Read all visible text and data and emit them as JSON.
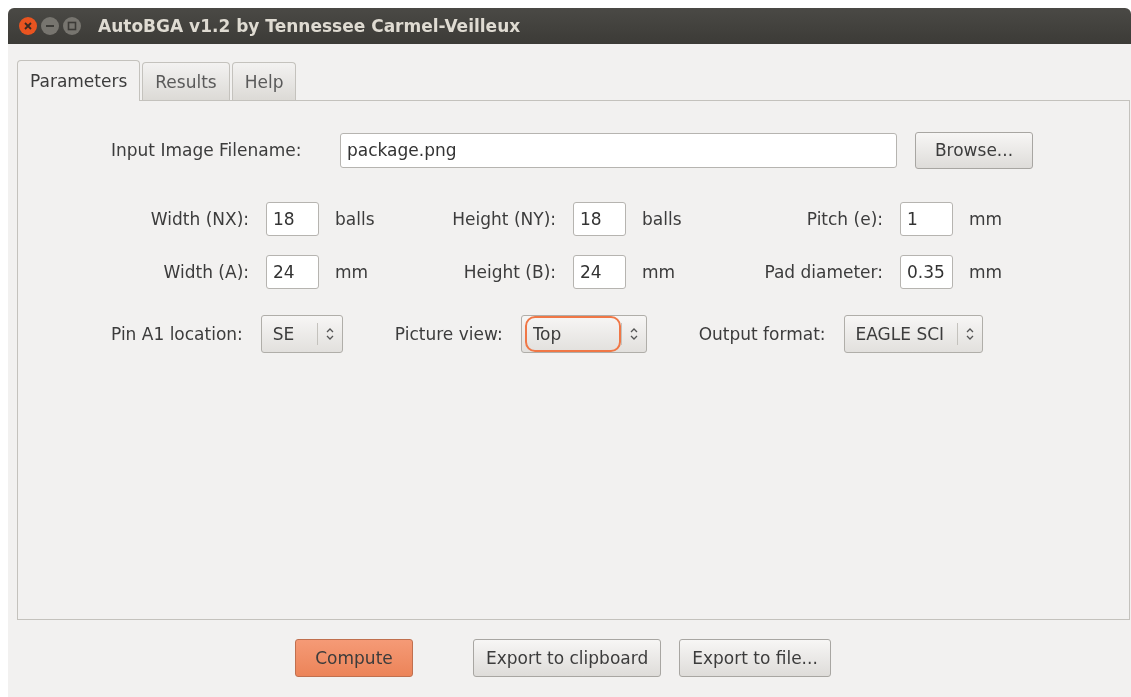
{
  "window": {
    "title": "AutoBGA v1.2 by Tennessee Carmel-Veilleux"
  },
  "tabs": [
    {
      "label": "Parameters",
      "selected": true
    },
    {
      "label": "Results",
      "selected": false
    },
    {
      "label": "Help",
      "selected": false
    }
  ],
  "filename": {
    "label": "Input Image Filename:",
    "value": "package.png",
    "button": "Browse..."
  },
  "grid_rows": [
    [
      {
        "label": "Width (NX):",
        "value": "18",
        "unit": "balls"
      },
      {
        "label": "Height (NY):",
        "value": "18",
        "unit": "balls"
      },
      {
        "label": "Pitch (e):",
        "value": "1",
        "unit": "mm"
      }
    ],
    [
      {
        "label": "Width (A):",
        "value": "24",
        "unit": "mm"
      },
      {
        "label": "Height (B):",
        "value": "24",
        "unit": "mm"
      },
      {
        "label": "Pad diameter:",
        "value": "0.35",
        "unit": "mm"
      }
    ]
  ],
  "selects": [
    {
      "label": "Pin A1 location:",
      "value": "SE",
      "focused": false
    },
    {
      "label": "Picture view:",
      "value": "Top",
      "focused": true
    },
    {
      "label": "Output format:",
      "value": "EAGLE SCI",
      "focused": false
    }
  ],
  "buttons": [
    {
      "label": "Compute",
      "default": true
    },
    {
      "label": "Export to clipboard",
      "default": false
    },
    {
      "label": "Export to file...",
      "default": false
    }
  ]
}
